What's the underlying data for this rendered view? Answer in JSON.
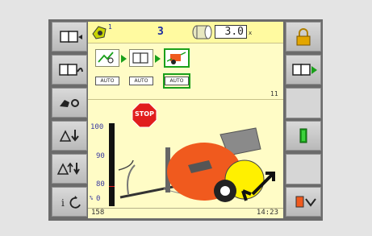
{
  "header": {
    "bale_count_sup": "1",
    "bale_total": "3",
    "knife_setting": "3.0",
    "knife_suffix": "x"
  },
  "functions": {
    "auto_labels": [
      "AUTO",
      "AUTO",
      "AUTO"
    ],
    "panel_number": "11"
  },
  "warning": {
    "stop_label": "STOP"
  },
  "density_scale": {
    "ticks": [
      "100",
      "90",
      "80"
    ],
    "bottom_label": "0",
    "unit": "%",
    "level_percent": 0
  },
  "status": {
    "left_value": "158",
    "clock": "14:23"
  },
  "colors": {
    "screen_bg": "#fffcc6",
    "topbar_bg": "#fffaa0",
    "selected_border": "#1aa01a",
    "baler_orange": "#f05a1e",
    "stop_red": "#e11d1d"
  },
  "icons": {
    "left": [
      "baler-mode-icon",
      "baler-next-icon",
      "pickup-settings-icon",
      "bale-lower-icon",
      "bale-raise-icon",
      "info-rotate-icon"
    ],
    "right": [
      "padlock-icon",
      "baler-forward-icon",
      "green-block-icon",
      "bale-eject-icon"
    ]
  }
}
